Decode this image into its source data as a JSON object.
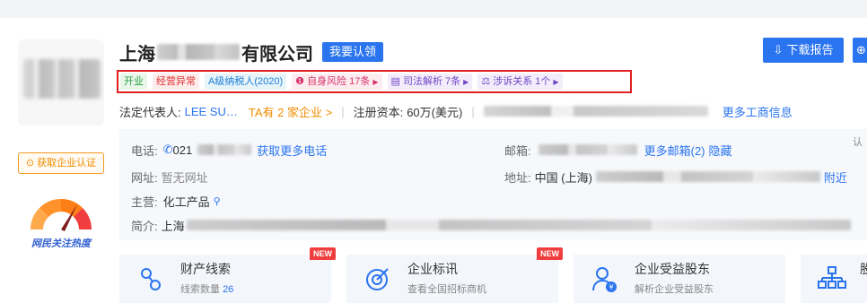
{
  "company": {
    "name_prefix": "上海",
    "name_suffix": "有限公司",
    "claim_label": "我要认领",
    "download_label": "下载报告"
  },
  "tags": [
    {
      "label": "开业",
      "style": "green",
      "arrow": false
    },
    {
      "label": "经营异常",
      "style": "red",
      "arrow": false
    },
    {
      "label": "A级纳税人(2020)",
      "style": "cyan",
      "arrow": false
    },
    {
      "label": "自身风险 17条",
      "style": "pink",
      "arrow": true,
      "icon": "shield-alert-icon"
    },
    {
      "label": "司法解析 7条",
      "style": "purple",
      "arrow": true,
      "icon": "book-icon"
    },
    {
      "label": "涉诉关系 1个",
      "style": "purple",
      "arrow": true,
      "icon": "gavel-icon"
    }
  ],
  "legal": {
    "rep_label": "法定代表人:",
    "rep_value": "LEE SU…",
    "ta_label": "TA有 2 家企业 >",
    "sep": "|",
    "capital_label": "注册资本:",
    "capital_value": "60万(美元)",
    "more_label": "更多工商信息"
  },
  "sidebar": {
    "auth_label": "获取企业认证",
    "heat_label": "网民关注热度"
  },
  "details": {
    "phone_label": "电话:",
    "phone_value": "021",
    "phone_more": "获取更多电话",
    "email_label": "邮箱:",
    "email_more": "更多邮箱(2)",
    "email_hide": "隐藏",
    "site_label": "网址:",
    "site_value": "暂无网址",
    "addr_label": "地址:",
    "addr_value": "中国 (上海)",
    "addr_nearby": "附近",
    "main_label": "主营:",
    "main_value": "化工产品",
    "intro_label": "简介:",
    "intro_value": "上海",
    "cert_mini": "认"
  },
  "features": [
    {
      "title": "财产线索",
      "sub": "线索数量",
      "count": "26",
      "new": true,
      "icon": "clue-icon"
    },
    {
      "title": "企业标讯",
      "sub": "查看全国招标商机",
      "count": "",
      "new": true,
      "icon": "target-icon"
    },
    {
      "title": "企业受益股东",
      "sub": "解析企业受益股东",
      "count": "",
      "new": false,
      "icon": "shareholder-icon"
    },
    {
      "title": "股",
      "sub": "",
      "count": "",
      "new": false,
      "icon": "org-chart-icon"
    }
  ],
  "badges": {
    "new_label": "NEW"
  },
  "colors": {
    "primary": "#2a74ef",
    "warning": "#f08c00",
    "danger": "#e02020"
  }
}
